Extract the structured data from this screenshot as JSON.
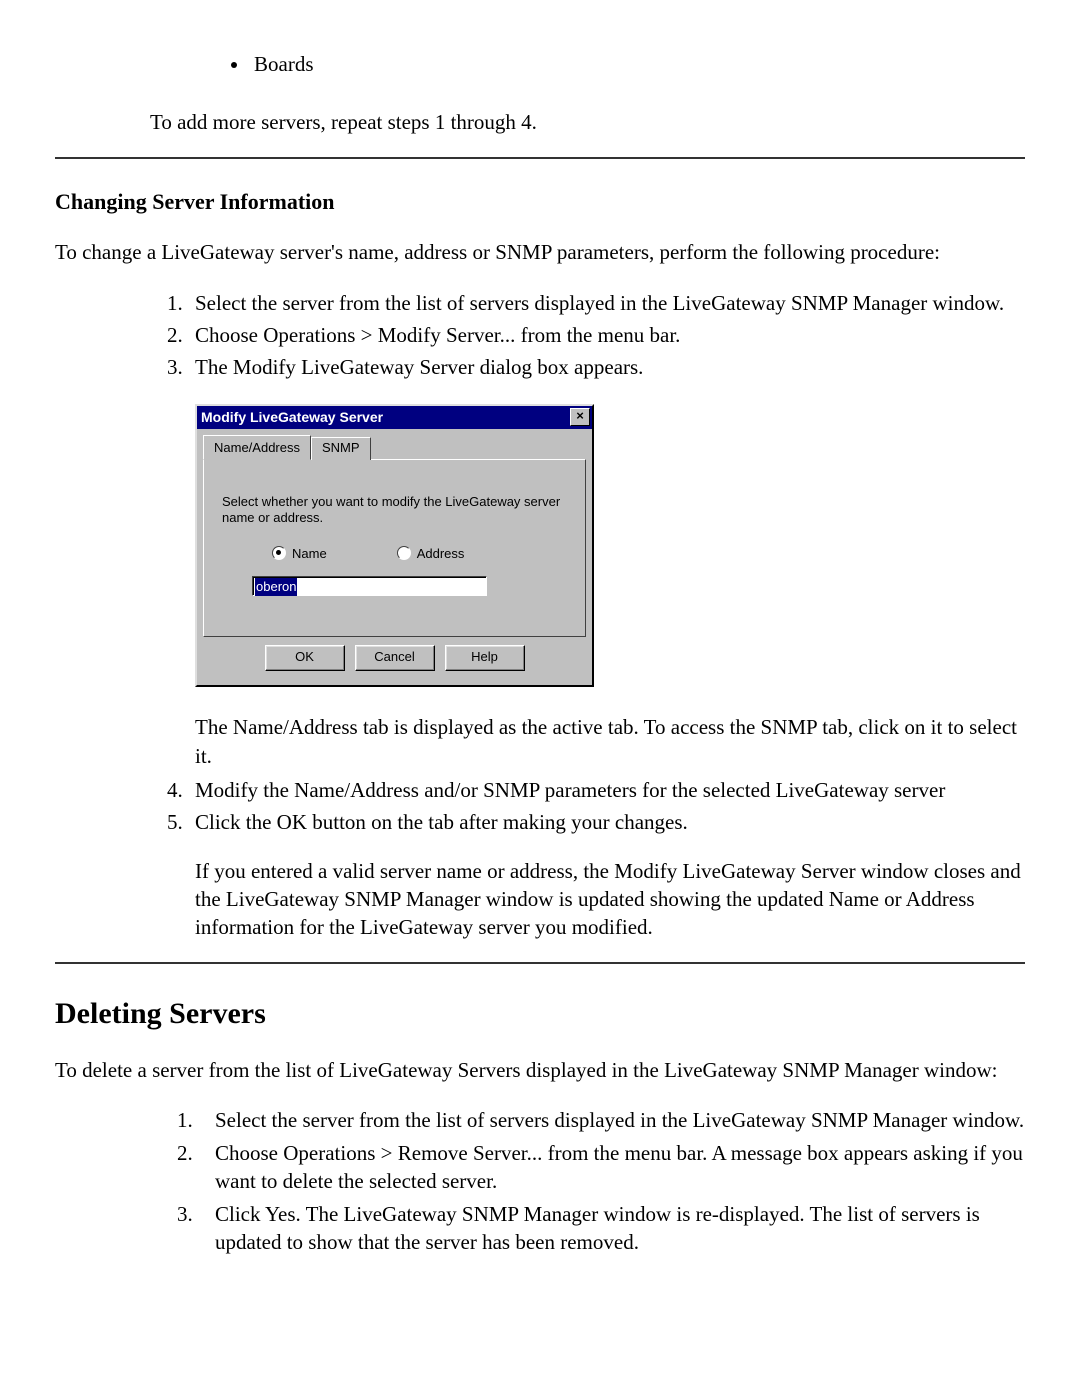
{
  "top": {
    "bullet_item": "Boards",
    "repeat_text": "To add more servers, repeat steps 1 through 4."
  },
  "changing": {
    "heading": "Changing Server Information",
    "intro": "To change a LiveGateway server's name, address or SNMP parameters, perform the following procedure:",
    "steps": {
      "s1": "Select the server from the list of servers displayed in the LiveGateway SNMP Manager window.",
      "s2": "Choose Operations > Modify Server... from the menu bar.",
      "s3": "The Modify LiveGateway Server dialog box appears.",
      "s3b": "The Name/Address tab is displayed as the active tab. To access the SNMP tab, click on it to select it.",
      "s4": "Modify the Name/Address and/or SNMP parameters for the selected LiveGateway server",
      "s5": "Click the OK button on the tab after making your changes.",
      "s5b": "If you entered a valid server name or address, the Modify LiveGateway Server window closes and the LiveGateway SNMP Manager window is updated showing the updated Name or Address information for the LiveGateway server you modified."
    }
  },
  "dialog": {
    "title": "Modify LiveGateway Server",
    "close_glyph": "×",
    "tab_active": "Name/Address",
    "tab_inactive": "SNMP",
    "instruction": "Select whether you want to modify the LiveGateway server name or address.",
    "radio_name": "Name",
    "radio_address": "Address",
    "field_value": "oberon",
    "ok": "OK",
    "cancel": "Cancel",
    "help": "Help"
  },
  "deleting": {
    "heading": "Deleting Servers",
    "intro": "To delete a server from the list of LiveGateway Servers displayed in the LiveGateway SNMP Manager window:",
    "steps": {
      "s1": "Select the server from the list of servers displayed in the LiveGateway SNMP Manager window.",
      "s2": "Choose Operations > Remove Server... from the menu bar. A message box appears asking if you want to delete the selected server.",
      "s3": "Click Yes. The LiveGateway SNMP Manager window is re-displayed. The list of servers is updated to show that the server has been removed."
    }
  }
}
